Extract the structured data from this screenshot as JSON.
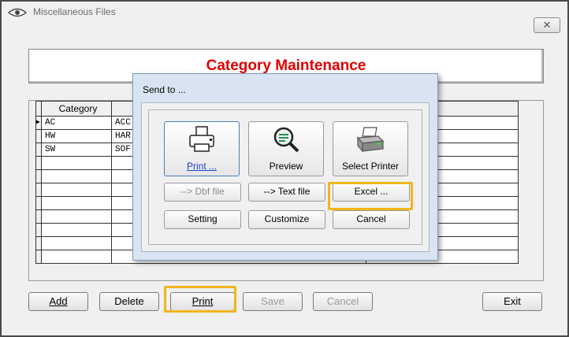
{
  "window": {
    "title": "Miscellaneous Files",
    "close_label": "✕"
  },
  "header": {
    "title": "Category Maintenance"
  },
  "grid": {
    "column_headers": [
      "Category",
      "",
      ""
    ],
    "rows": [
      {
        "category": "AC",
        "description": "ACC"
      },
      {
        "category": "HW",
        "description": "HAR"
      },
      {
        "category": "SW",
        "description": "SOF"
      }
    ],
    "selected_row_marker": "▶"
  },
  "toolbar": {
    "add_label": "Add",
    "delete_label": "Delete",
    "print_label": "Print",
    "save_label": "Save",
    "cancel_label": "Cancel",
    "exit_label": "Exit"
  },
  "send_dialog": {
    "title": "Send to ...",
    "print_label": "Print ...",
    "preview_label": "Preview",
    "select_printer_label": "Select Printer",
    "dbf_label": "--> Dbf file",
    "text_label": "--> Text file",
    "excel_label": "Excel ...",
    "setting_label": "Setting",
    "customize_label": "Customize",
    "cancel_label": "Cancel"
  },
  "colors": {
    "title_red": "#e00000",
    "highlight": "#f2b61b",
    "dialog_bg": "#d8e4f1"
  },
  "icons": {
    "window": "eye-icon",
    "print": "printer-icon",
    "preview": "magnifier-icon",
    "select_printer": "printer-select-icon"
  }
}
